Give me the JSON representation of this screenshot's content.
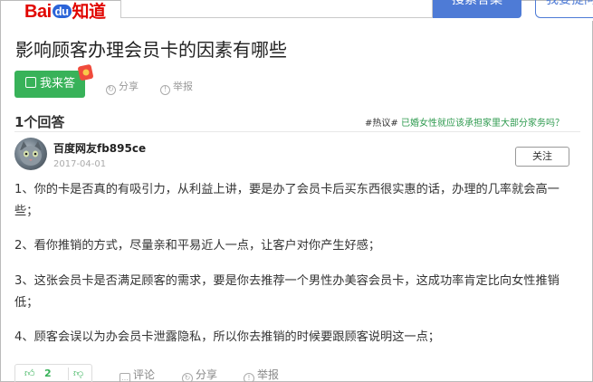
{
  "header": {
    "logo_bai": "Bai",
    "logo_du": "du",
    "logo_zhidao": "知道",
    "search_button": "搜索答案",
    "ask_button": "我要提问"
  },
  "question": {
    "title": "影响顾客办理会员卡的因素有哪些",
    "answer_button": "我来答",
    "share": "分享",
    "report": "举报"
  },
  "answers_header": {
    "count": "1个回答",
    "hot_tag": "#热议#",
    "hot_link": "已婚女性就应该承担家里大部分家务吗？"
  },
  "answer": {
    "username": "百度网友fb895ce",
    "date": "2017-04-01",
    "follow": "关注",
    "paragraphs": [
      "1、你的卡是否真的有吸引力，从利益上讲，要是办了会员卡后买东西很实惠的话，办理的几率就会高一些；",
      "2、看你推销的方式，尽量亲和平易近人一点，让客户对你产生好感；",
      "3、这张会员卡是否满足顾客的需求，要是你去推荐一个男性办美容会员卡，这成功率肯定比向女性推销低；",
      "4、顾客会误以为办会员卡泄露隐私，所以你去推销的时候要跟顾客说明这一点；"
    ],
    "upvotes": "2",
    "comment": "评论",
    "share": "分享",
    "report": "举报"
  },
  "icons": [
    "edit-icon",
    "red-packet-icon",
    "share-icon",
    "report-icon",
    "thumb-up-icon",
    "thumb-down-icon",
    "comment-icon"
  ],
  "colors": {
    "brand_red": "#e10601",
    "brand_blue": "#2b64d8",
    "green": "#38b259",
    "search_blue": "#4e7bd6"
  }
}
